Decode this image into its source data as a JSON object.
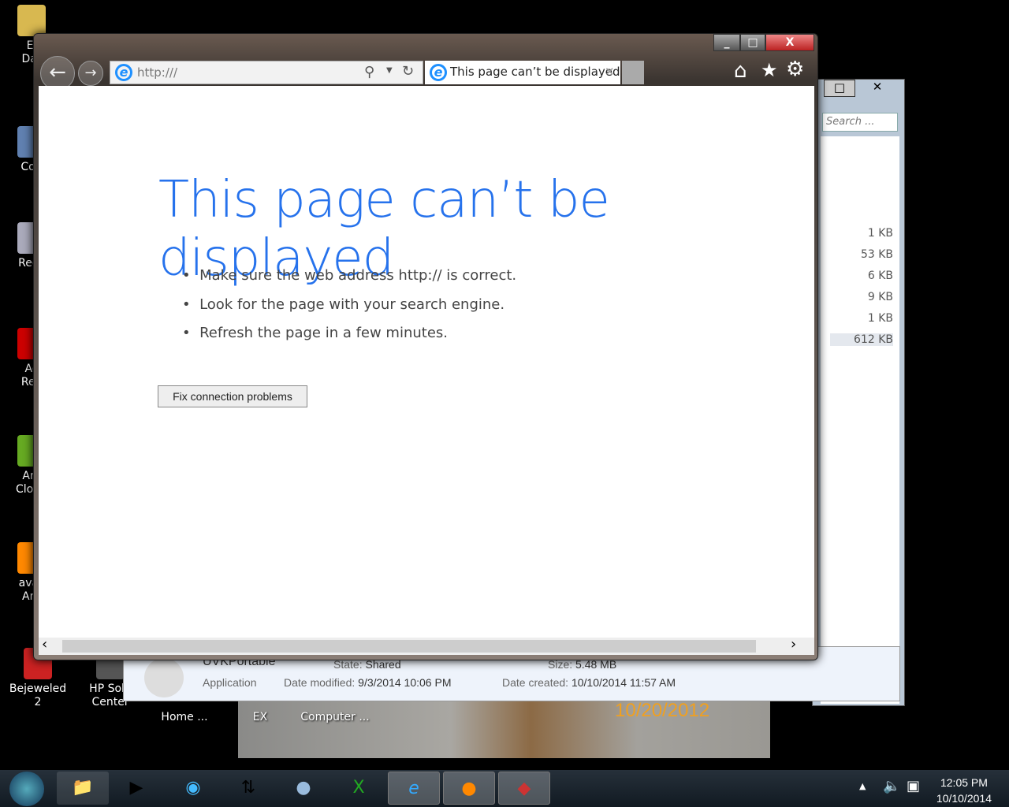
{
  "desktop": {
    "icons": [
      {
        "label": "El\nDar",
        "color": "#d8b850"
      },
      {
        "label": "Con",
        "color": "#6080b0"
      },
      {
        "label": "Recy",
        "color": "#aab"
      },
      {
        "label": "Ac\nRea",
        "color": "#c00"
      },
      {
        "label": "Am\nCloud",
        "color": "#6a2"
      },
      {
        "label": "avas\nAnt",
        "color": "#f80"
      },
      {
        "label": "Bejeweled 2",
        "color": "#c22"
      },
      {
        "label": "HP Solu\nCenter",
        "color": "#555"
      },
      {
        "label": "Home ..."
      },
      {
        "label": "EX"
      },
      {
        "label": "Computer ..."
      }
    ],
    "photo_date": "10/20/2012"
  },
  "explorer": {
    "search_placeholder": "Search ...",
    "sizes": [
      "1 KB",
      "53 KB",
      "6 KB",
      "9 KB",
      "1 KB",
      "612 KB"
    ],
    "details": {
      "name": "UVKPortable",
      "type": "Application",
      "state_label": "State:",
      "state": "Shared",
      "size_label": "Size:",
      "size": "5.48 MB",
      "modified_label": "Date modified:",
      "modified": "9/3/2014 10:06 PM",
      "created_label": "Date created:",
      "created": "10/10/2014 11:57 AM"
    }
  },
  "browser": {
    "address": "http:///",
    "tab_title": "This page can’t be displayed",
    "heading": "This page can’t be displayed",
    "bullets": [
      "Make sure the web address http:// is correct.",
      "Look for the page with your search engine.",
      "Refresh the page in a few minutes."
    ],
    "fix_button": "Fix connection problems"
  },
  "taskbar": {
    "time": "12:05 PM",
    "date": "10/10/2014"
  }
}
